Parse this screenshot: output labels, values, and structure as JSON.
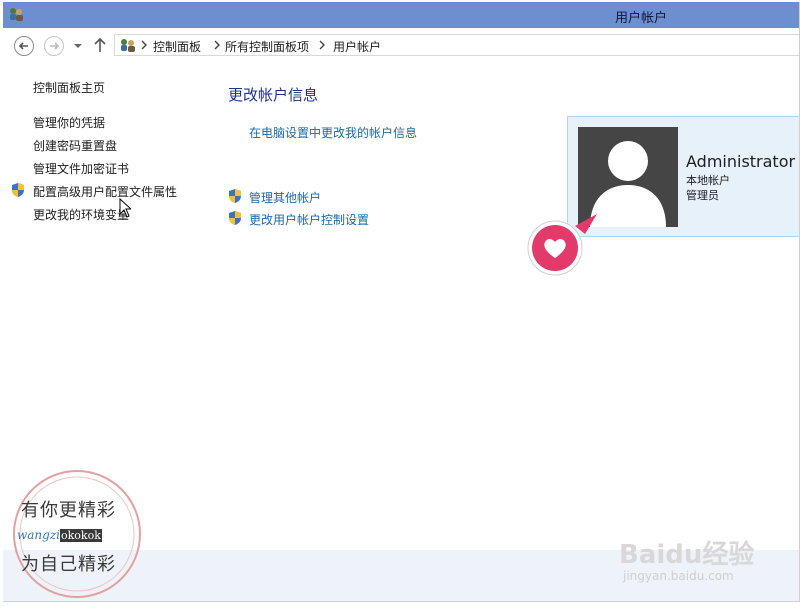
{
  "window": {
    "title": "用户帐户"
  },
  "breadcrumb": {
    "items": [
      "控制面板",
      "所有控制面板项",
      "用户帐户"
    ]
  },
  "leftnav": {
    "items": [
      {
        "label": "控制面板主页",
        "shield": false
      },
      {
        "label": "管理你的凭据",
        "shield": false
      },
      {
        "label": "创建密码重置盘",
        "shield": false
      },
      {
        "label": "管理文件加密证书",
        "shield": false
      },
      {
        "label": "配置高级用户配置文件属性",
        "shield": true
      },
      {
        "label": "更改我的环境变量",
        "shield": false
      }
    ]
  },
  "main": {
    "title": "更改帐户信息",
    "links": [
      {
        "label": "在电脑设置中更改我的帐户信息",
        "shield": false
      },
      {
        "label": "管理其他帐户",
        "shield": true
      },
      {
        "label": "更改用户帐户控制设置",
        "shield": true
      }
    ]
  },
  "account": {
    "name": "Administrator",
    "type": "本地帐户",
    "role": "管理员"
  },
  "watermark": {
    "line1": "有你更精彩",
    "line2_a": "wangzi",
    "line2_b": "okokok",
    "line3": "为自己精彩",
    "baidu": "Baidu经验",
    "baidu_sub": "jingyan.baidu.com"
  },
  "colors": {
    "titlebar": "#6e8fcf",
    "link": "#1d67a7",
    "heading": "#1e3287",
    "tile_bg": "#e6f1fa",
    "heart": "#e23a6a"
  }
}
